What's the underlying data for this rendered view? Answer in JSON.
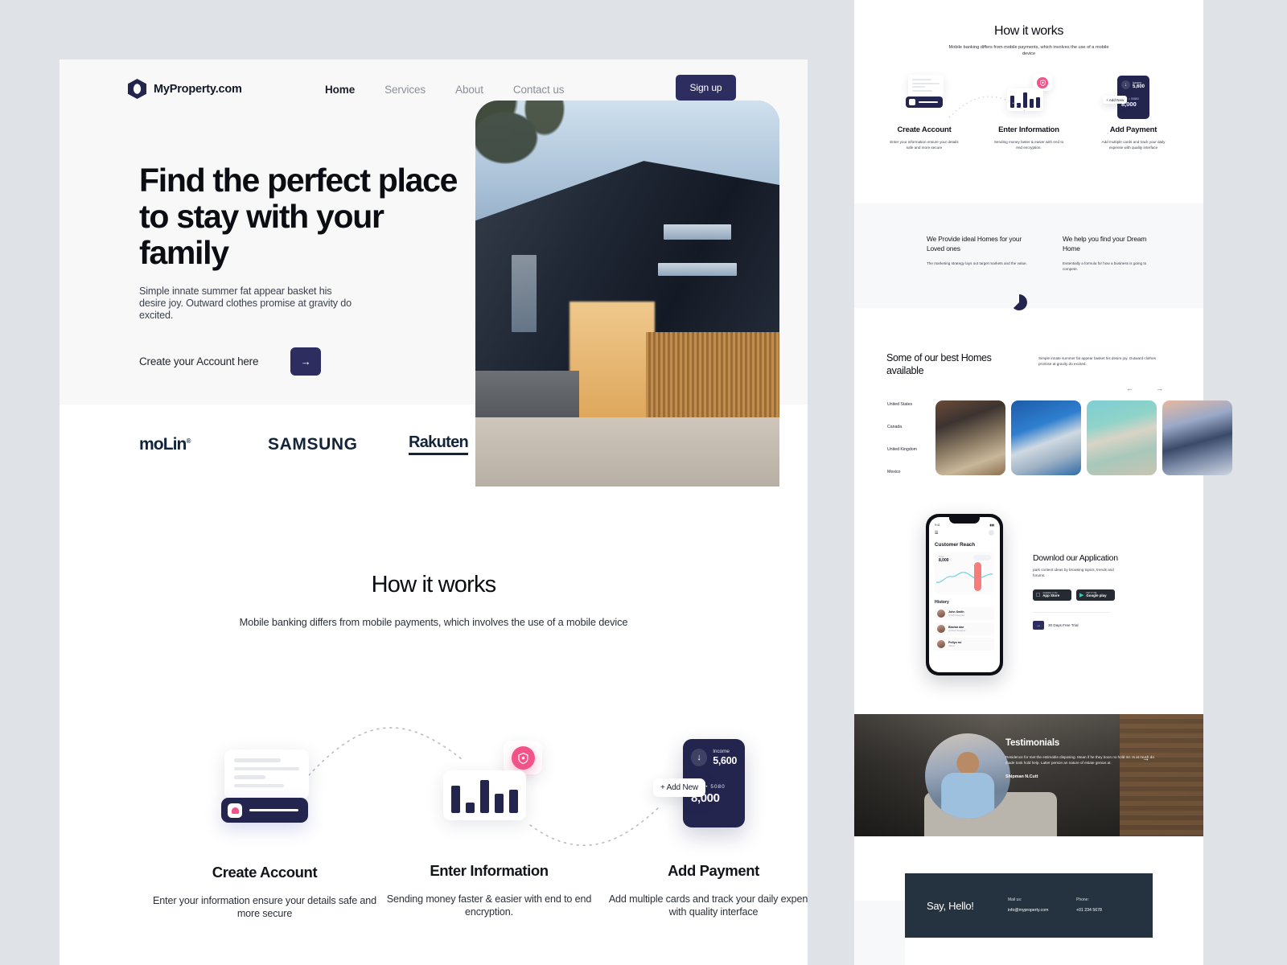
{
  "colors": {
    "navy": "#2d2e5f",
    "dark_navy": "#23254f",
    "pink": "#f2548a",
    "footer_bg": "#24333f",
    "page_bg": "#dfe3e8"
  },
  "header": {
    "brand": "MyProperty.com",
    "menu": [
      {
        "label": "Home",
        "active": true
      },
      {
        "label": "Services",
        "active": false
      },
      {
        "label": "About",
        "active": false
      },
      {
        "label": "Contact us",
        "active": false
      }
    ],
    "signup_label": "Sign up"
  },
  "hero": {
    "title": "Find the perfect place to stay with your family",
    "subtitle": "Simple innate summer fat appear basket his desire joy. Outward clothes promise at gravity do excited.",
    "cta_label": "Create your Account here",
    "cta_arrow": "→"
  },
  "logos": [
    {
      "name": "moLin",
      "mark": "®"
    },
    {
      "name": "SAMSUNG"
    },
    {
      "name": "Rakuten"
    }
  ],
  "how_it_works": {
    "title": "How it works",
    "subtitle": "Mobile banking differs from mobile payments, which involves the use of a mobile device",
    "steps": [
      {
        "title": "Create Account",
        "desc": "Enter your information ensure your details safe and more secure"
      },
      {
        "title": "Enter Information",
        "desc": "Sending money faster & easier with end to end encryption."
      },
      {
        "title": "Add Payment",
        "desc": "Add multiple cards and track your daily expense with quality interface"
      }
    ],
    "pay_card": {
      "income_label": "Income",
      "income_value": "5,600",
      "card_mask": "• • • •  5080",
      "card_amount": "8,000",
      "add_new_label": "+ Add New",
      "income_icon": "↓"
    }
  },
  "provide": {
    "left_title": "We Provide ideal Homes for your Loved ones",
    "left_desc": "The marketing strategy lays out target markets and the value.",
    "right_title": "We help you find your Dream Home",
    "right_desc": "Essentially a formula for how a business is going to compete."
  },
  "homes": {
    "title": "Some of our best Homes available",
    "desc": "Simple innate summer fat appear basket his desire joy. Outward clothes promise at gravity do excited.",
    "countries": [
      "United States",
      "Canada",
      "United Kingdom",
      "Mexico"
    ],
    "prev_icon": "←",
    "next_icon": "→"
  },
  "app": {
    "title": "Downlod our Application",
    "desc": "park content ideas by browsing topics, trends and forums.",
    "stores": [
      {
        "small": "Available on the",
        "big": "App Store",
        "glyph": ""
      },
      {
        "small": "GET IT ON",
        "big": "Google play",
        "glyph": "▶"
      }
    ],
    "trial_label": "30 Days Free Trial",
    "trial_icon": "→"
  },
  "phone": {
    "status_time": "9:41",
    "status_right": "▮▮▮",
    "menu_icon": "☰",
    "title": "Customer Reach",
    "total_label": "Total",
    "total_value": "8,000",
    "period": "Month",
    "history_label": "History",
    "rows": [
      {
        "name": "John Smith",
        "role": "UI/UX Designer"
      },
      {
        "name": "Bashar dae",
        "role": "product designer"
      },
      {
        "name": "Pollyo roi",
        "role": "officer"
      }
    ]
  },
  "testimonials": {
    "title": "Testimonials",
    "quote": "Residence for met the estimable disposing. Mean if he they boon no hold mr. Is at much do made took hold help. Latter person an nature of estate genius at.",
    "author": "Shipman N.Cutt",
    "next_icon": "→"
  },
  "footer": {
    "greeting": "Say, Hello!",
    "mail_label": "Mail us:",
    "mail_value": "info@myproperty.com",
    "phone_label": "Phone:",
    "phone_value": "+01 234 5678"
  }
}
